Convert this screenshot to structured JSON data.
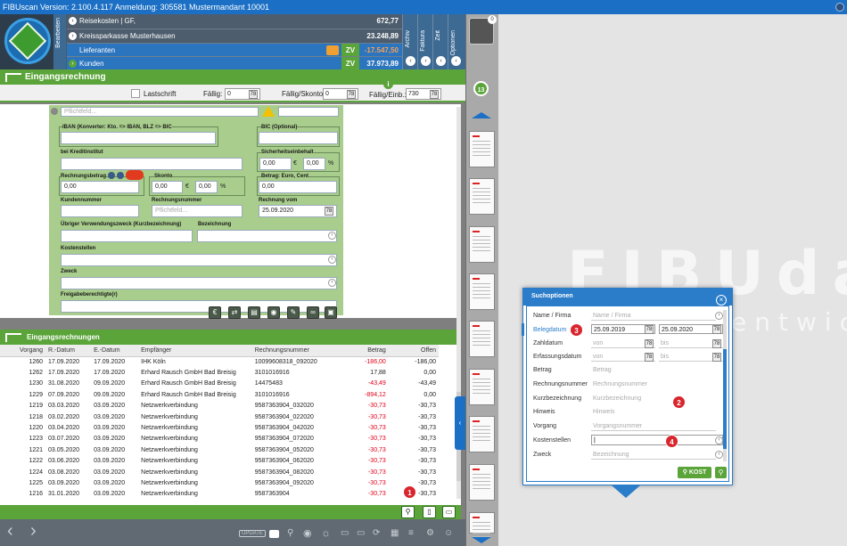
{
  "window": {
    "title": "FIBUscan Version: 2.100.4.117 Anmeldung: 305581 Mustermandant 10001"
  },
  "header": {
    "bearbeiten_label": "Bearbeiten",
    "rows": [
      {
        "label": "Reisekosten | GF,",
        "amount": "672,77"
      },
      {
        "label": "Kreissparkasse Musterhausen",
        "amount": "23.248,89"
      },
      {
        "label": "Lieferanten",
        "flag": "ZV",
        "amount": "-17.547,50"
      },
      {
        "label": "Kunden",
        "flag": "ZV",
        "amount": "37.973,89"
      }
    ],
    "side_tabs": [
      "Archiv",
      "Faktura",
      "Zeit",
      "Optionen"
    ]
  },
  "section": {
    "title": "Eingangsrechnung",
    "lastschrift_label": "Lastschrift",
    "faellig_label": "Fällig:",
    "faellig_value": "0",
    "faellig_skonto_label": "Fällig/Skonto:",
    "faellig_skonto_value": "0",
    "faellig_einb_label": "Fällig/Einb.:",
    "faellig_einb_value": "730"
  },
  "form": {
    "pflichtfeld_placeholder": "Pflichtfeld...",
    "iban_label": "IBAN (Konverter: Kto. => IBAN, BLZ => BIC",
    "bic_label": "BIC (Optional)",
    "kreditinstitut_label": "bei Kreditinstitut",
    "sicherheitseinbehalt_label": "Sicherheitseinbehalt",
    "sicherheit_value": "0,00",
    "sicherheit_pct": "0,00",
    "euro_sign": "€",
    "pct_sign": "%",
    "rechnungsbetrag_label": "Rechnungsbetrag",
    "rechnungsbetrag_value": "0,00",
    "skonto_label": "Skonto",
    "skonto_value": "0,00",
    "skonto_pct": "0,00",
    "betrag_euro_label": "Betrag: Euro, Cent",
    "betrag_euro_value": "0,00",
    "kundennummer_label": "Kundennummer",
    "rechnungsnummer_label": "Rechnungsnummer",
    "rechnung_vom_label": "Rechnung vom",
    "rechnung_vom_value": "25.09.2020",
    "verwendungszweck_label": "Übriger Verwendungszweck (Kurzbezeichnung)",
    "bezeichnung_label": "Bezeichnung",
    "kostenstellen_label": "Kostenstellen",
    "zweck_label": "Zweck",
    "freigabe_label": "Freigabeberechtigte(r)"
  },
  "list": {
    "title": "Eingangsrechnungen",
    "columns": [
      "Vorgang",
      "R.-Datum",
      "E.-Datum",
      "Empfänger",
      "Rechnungsnummer",
      "Betrag",
      "Offen"
    ],
    "rows": [
      [
        "1260",
        "17.09.2020",
        "17.09.2020",
        "IHK Köln",
        "10099608318_092020",
        "-186,00",
        "-186,00"
      ],
      [
        "1262",
        "17.09.2020",
        "17.09.2020",
        "Erhard Rausch GmbH Bad Breisig",
        "3101016916",
        "17,88",
        "0,00"
      ],
      [
        "1230",
        "31.08.2020",
        "09.09.2020",
        "Erhard Rausch GmbH Bad Breisig",
        "14475483",
        "-43,49",
        "-43,49"
      ],
      [
        "1229",
        "07.09.2020",
        "09.09.2020",
        "Erhard Rausch GmbH Bad Breisig",
        "3101016916",
        "-894,12",
        "0,00"
      ],
      [
        "1219",
        "03.03.2020",
        "03.09.2020",
        "Netzwerkverbindung",
        "9587363904_032020",
        "-30,73",
        "-30,73"
      ],
      [
        "1218",
        "03.02.2020",
        "03.09.2020",
        "Netzwerkverbindung",
        "9587363904_022020",
        "-30,73",
        "-30,73"
      ],
      [
        "1220",
        "03.04.2020",
        "03.09.2020",
        "Netzwerkverbindung",
        "9587363904_042020",
        "-30,73",
        "-30,73"
      ],
      [
        "1223",
        "03.07.2020",
        "03.09.2020",
        "Netzwerkverbindung",
        "9587363904_072020",
        "-30,73",
        "-30,73"
      ],
      [
        "1221",
        "03.05.2020",
        "03.09.2020",
        "Netzwerkverbindung",
        "9587363904_052020",
        "-30,73",
        "-30,73"
      ],
      [
        "1222",
        "03.06.2020",
        "03.09.2020",
        "Netzwerkverbindung",
        "9587363904_062020",
        "-30,73",
        "-30,73"
      ],
      [
        "1224",
        "03.08.2020",
        "03.09.2020",
        "Netzwerkverbindung",
        "9587363904_082020",
        "-30,73",
        "-30,73"
      ],
      [
        "1225",
        "03.09.2020",
        "03.09.2020",
        "Netzwerkverbindung",
        "9587363904_092020",
        "-30,73",
        "-30,73"
      ],
      [
        "1216",
        "31.01.2020",
        "03.09.2020",
        "Netzwerkverbindung",
        "9587363904",
        "-30,73",
        "-30,73"
      ]
    ]
  },
  "strip": {
    "count": "13",
    "top_badge": "0"
  },
  "bottombar": {
    "update_label": "UPDATE"
  },
  "brand": {
    "big": "FIBUda",
    "small": "entwic"
  },
  "dialog": {
    "title": "Suchoptionen",
    "fields": [
      {
        "label": "Name / Firma",
        "placeholder": "Name / Firma"
      },
      {
        "label": "Belegdatum",
        "from": "25.09.2019",
        "to": "25.09.2020"
      },
      {
        "label": "Zahldatum",
        "from_ph": "von",
        "to_ph": "bis"
      },
      {
        "label": "Erfassungsdatum",
        "from_ph": "von",
        "to_ph": "bis"
      },
      {
        "label": "Betrag",
        "placeholder": "Betrag"
      },
      {
        "label": "Rechnungsnummer",
        "placeholder": "Rechnungsnummer"
      },
      {
        "label": "Kurzbezeichnung",
        "placeholder": "Kurzbezeichnung"
      },
      {
        "label": "Hinweis",
        "placeholder": "Hinweis"
      },
      {
        "label": "Vorgang",
        "placeholder": "Vorgangsnummer"
      },
      {
        "label": "Kostenstellen",
        "placeholder": ""
      },
      {
        "label": "Zweck",
        "placeholder": "Bezeichnung"
      }
    ],
    "kost_label": "KOST"
  },
  "badges": [
    "1",
    "2",
    "3",
    "4"
  ],
  "colors": {
    "titlebar": "#1b6fc4",
    "green": "#5aa43a",
    "negative": "#e0001a",
    "dialog_blue": "#2b7dc9",
    "badge_red": "#d9262e"
  }
}
